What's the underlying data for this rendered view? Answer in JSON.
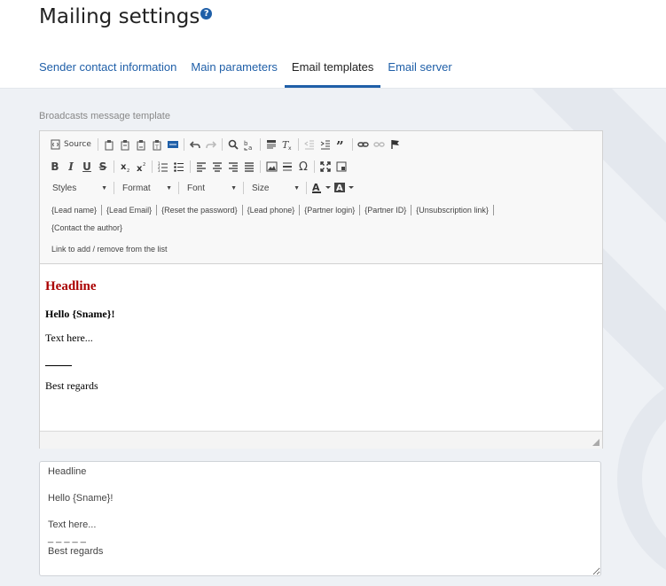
{
  "page": {
    "title": "Mailing settings",
    "help_icon": "?"
  },
  "tabs": [
    {
      "label": "Sender contact information",
      "active": false
    },
    {
      "label": "Main parameters",
      "active": false
    },
    {
      "label": "Email templates",
      "active": true
    },
    {
      "label": "Email server",
      "active": false
    }
  ],
  "section": {
    "label": "Broadcasts message template"
  },
  "toolbar": {
    "source_label": "Source",
    "styles_label": "Styles",
    "format_label": "Format",
    "font_label": "Font",
    "size_label": "Size",
    "bold_label": "B",
    "italic_label": "I",
    "underline_label": "U",
    "strike_label": "S",
    "special_char_label": "Ω",
    "placeholders": [
      "{Lead name}",
      "{Lead Email}",
      "{Reset the password}",
      "{Lead phone}",
      "{Partner login}",
      "{Partner ID}",
      "{Unsubscription link}"
    ],
    "placeholder_contact_author": "{Contact the author}",
    "link_list_label": "Link to add / remove from the list"
  },
  "content": {
    "headline": "Headline",
    "greeting": "Hello {Sname}!",
    "body": "Text here...",
    "sign_off": "Best regards"
  },
  "textarea": {
    "value": "Headline\n\nHello {Sname}!\n\nText here...\n_ _ _ _ _\nBest regards"
  },
  "colors": {
    "accent": "#1f5fa8",
    "headline": "#aa0000",
    "background": "#eef1f5"
  }
}
